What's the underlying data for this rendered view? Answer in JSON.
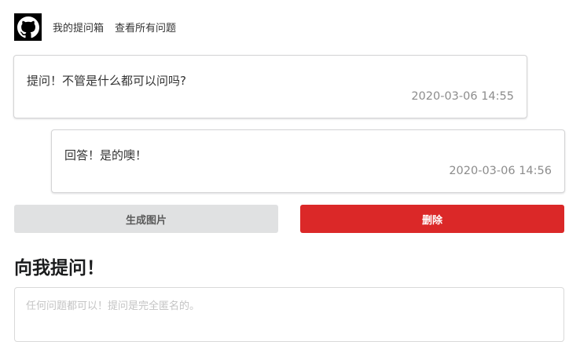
{
  "nav": {
    "logo_icon": "github-icon",
    "links": [
      {
        "label": "我的提问箱"
      },
      {
        "label": "查看所有问题"
      }
    ]
  },
  "question": {
    "text": "提问！不管是什么都可以问吗?",
    "time": "2020-03-06 14:55"
  },
  "answer": {
    "text": "回答！是的噢！",
    "time": "2020-03-06 14:56"
  },
  "actions": {
    "generate_label": "生成图片",
    "delete_label": "删除",
    "delete_color": "#db2828",
    "generate_color": "#e0e1e2"
  },
  "ask": {
    "heading": "向我提问！",
    "placeholder": "任何问题都可以！提问是完全匿名的。"
  }
}
